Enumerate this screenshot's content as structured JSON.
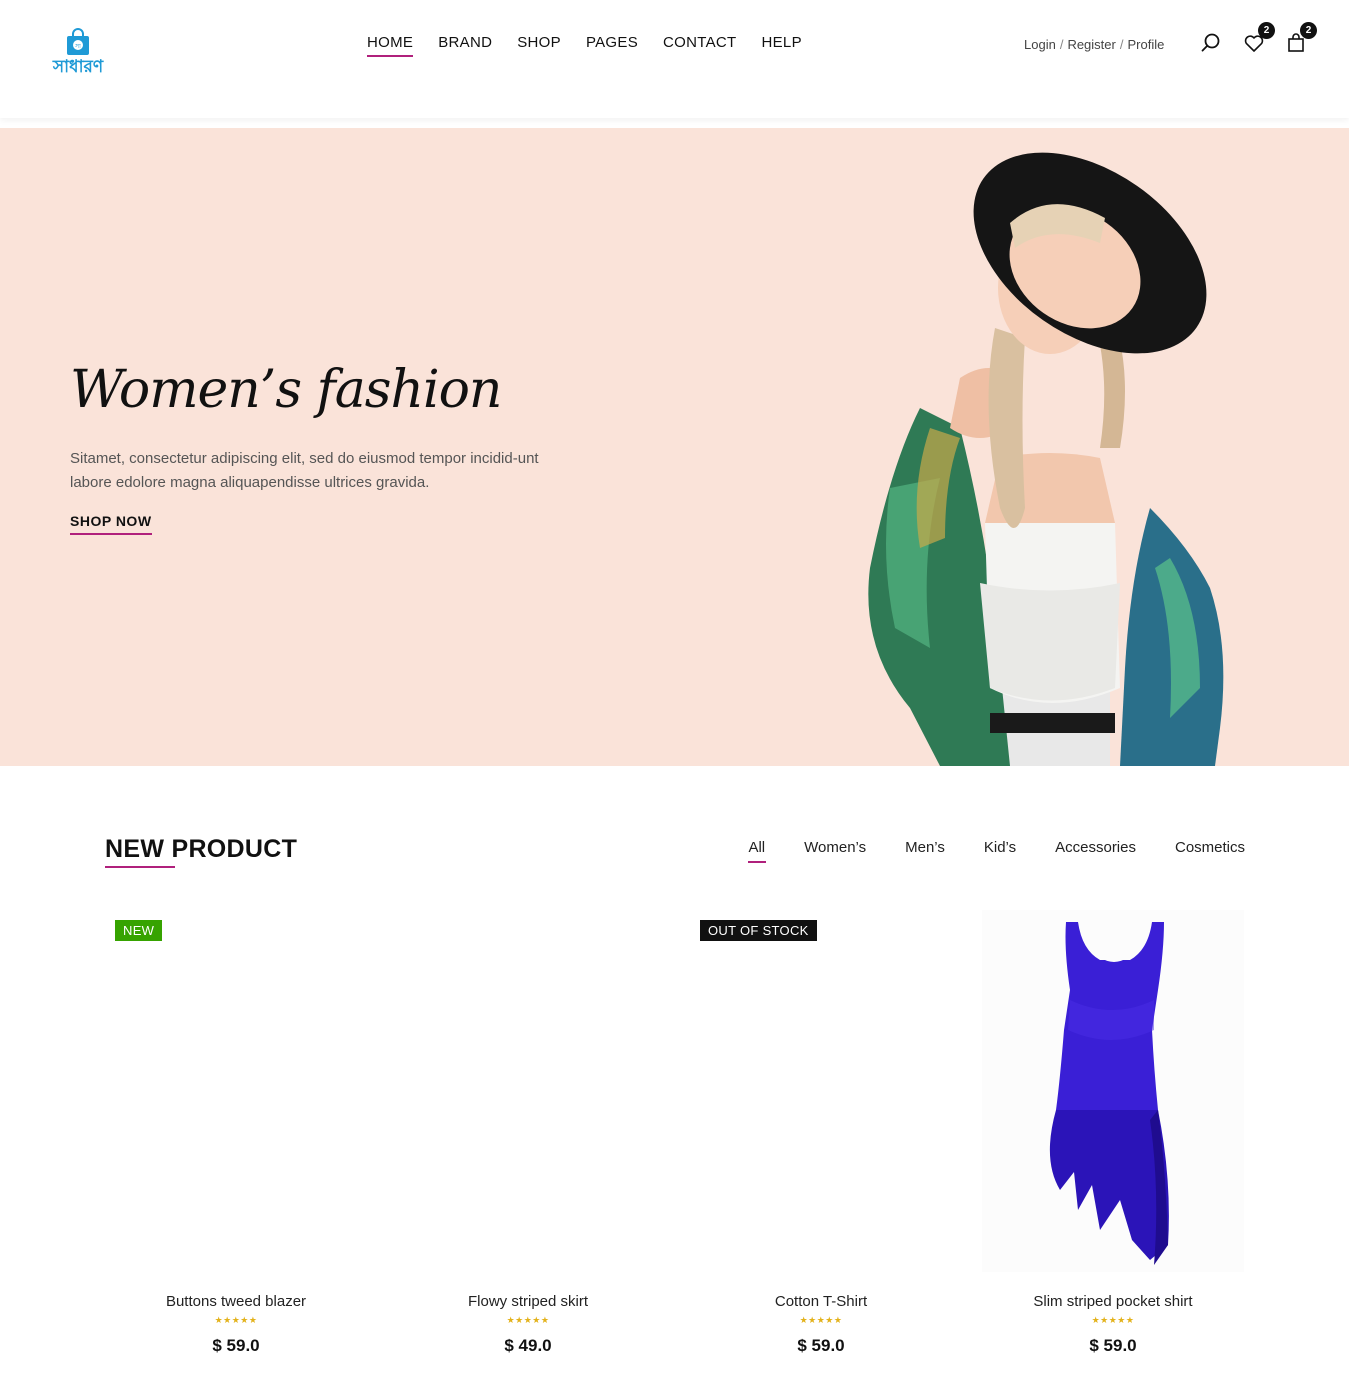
{
  "header": {
    "logo_text": "সাধারণ",
    "logo_bag_letter": "সা",
    "nav": [
      "HOME",
      "BRAND",
      "SHOP",
      "PAGES",
      "CONTACT",
      "HELP"
    ],
    "account": {
      "login": "Login",
      "register": "Register",
      "profile": "Profile",
      "separator": "/"
    },
    "wishlist_count": "2",
    "cart_count": "2",
    "icons": [
      "search-icon",
      "heart-icon",
      "bag-icon"
    ]
  },
  "hero": {
    "title": "Women’s fashion",
    "text": "Sitamet, consectetur adipiscing elit, sed do eiusmod tempor incidid-unt labore edolore magna aliquapendisse ultrices gravida.",
    "cta": "SHOP NOW"
  },
  "new_product": {
    "title": "NEW PRODUCT",
    "filters": [
      "All",
      "Women’s",
      "Men’s",
      "Kid’s",
      "Accessories",
      "Cosmetics"
    ],
    "products": [
      {
        "name": "Buttons tweed blazer",
        "price": "$ 59.0",
        "label": "NEW",
        "stars": "★★★★★"
      },
      {
        "name": "Flowy striped skirt",
        "price": "$ 49.0",
        "label": "",
        "stars": "★★★★★"
      },
      {
        "name": "Cotton T-Shirt",
        "price": "$ 59.0",
        "label": "OUT OF STOCK",
        "stars": "★★★★★"
      },
      {
        "name": "Slim striped pocket shirt",
        "price": "$ 59.0",
        "label": "",
        "stars": "★★★★★"
      }
    ]
  },
  "colors": {
    "accent": "#b0207c",
    "hero_bg": "#fae3d9",
    "logo_blue": "#1f9ad6",
    "new_label": "#36a300",
    "star": "#e3b21b"
  }
}
